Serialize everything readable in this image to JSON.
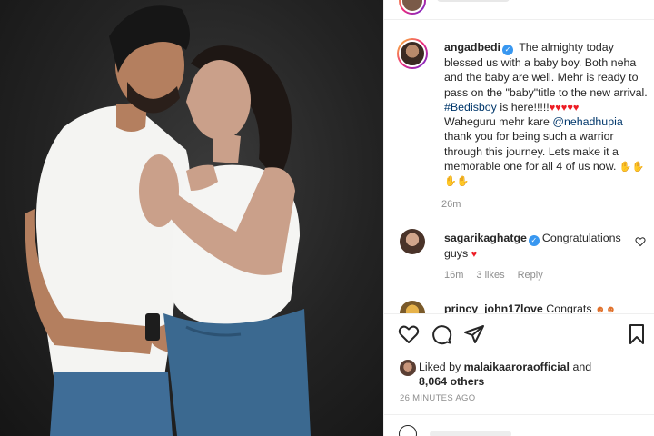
{
  "post": {
    "author": "angadbedi",
    "caption_lines": [
      "The almighty today",
      "blessed us with a baby boy. Both neha",
      "and the baby are well. Mehr is ready to",
      "pass on the \"baby\"title to the new arrival.",
      "#Bedisboy",
      " is here!!!!!",
      "Waheguru mehr kare ",
      "@nehadhupia",
      "thank you for being such a warrior",
      "through this journey. Lets make it a",
      "memorable one for all 4 of us now."
    ],
    "time": "26m"
  },
  "comments": [
    {
      "user": "sagarikaghatge",
      "text_1": "Congratulations",
      "text_2": "guys",
      "time": "16m",
      "likes": "3 likes",
      "reply": "Reply"
    },
    {
      "user": "princy_john17love",
      "text_1": "Congrats"
    }
  ],
  "likes": {
    "prefix": "Liked by ",
    "user": "malaikaaroraofficial",
    "and": " and",
    "others": "8,064 others"
  },
  "post_time": "26 MINUTES AGO",
  "icons": {
    "like": "heart-outline-icon",
    "comment": "comment-bubble-icon",
    "share": "paper-plane-icon",
    "save": "bookmark-icon"
  },
  "colors": {
    "verified": "#3897f0",
    "link": "#00376b",
    "muted": "#8e8e8e",
    "heart": "#ed1c24"
  }
}
